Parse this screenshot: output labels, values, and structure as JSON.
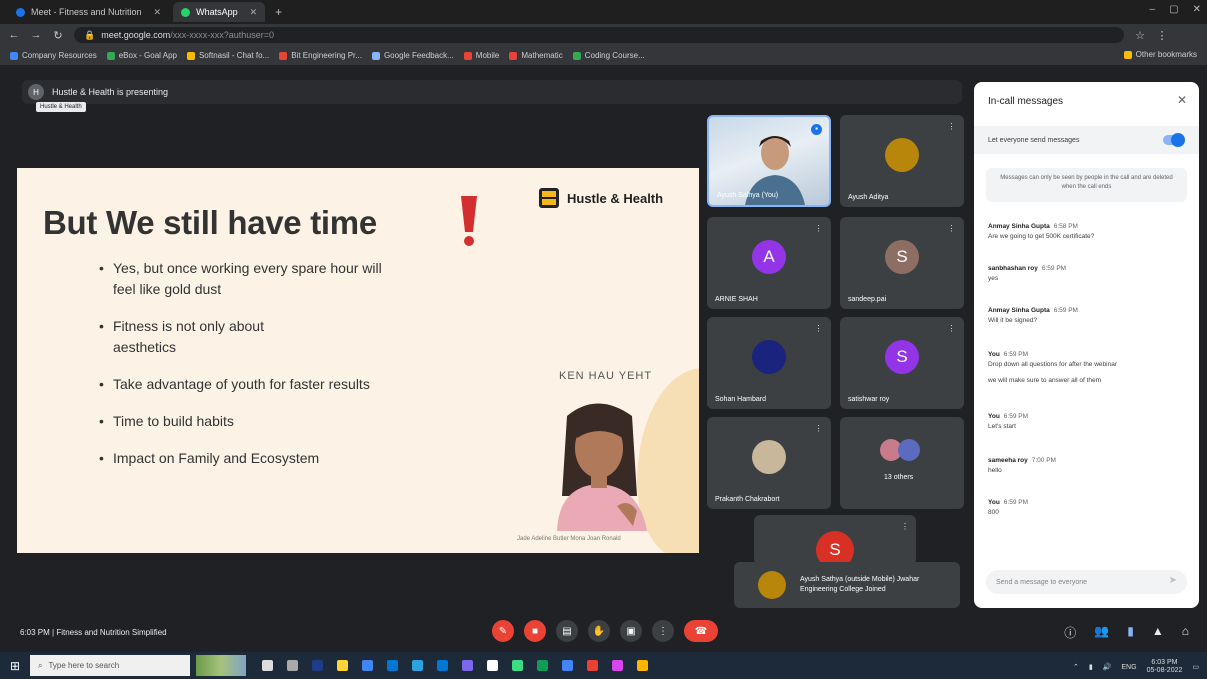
{
  "browser": {
    "tabs": [
      {
        "label": "Meet - Fitness and Nutrition",
        "active": false,
        "color": "#1a73e8"
      },
      {
        "label": "WhatsApp",
        "active": true,
        "color": "#25d366"
      }
    ],
    "new_tab": "+",
    "url": "meet.google.com",
    "url_rest": "/xxx-xxxx-xxx?authuser=0",
    "window_controls": [
      "–",
      "▢",
      "✕"
    ]
  },
  "bookmarks": {
    "items": [
      "Company Resources",
      "eBox - Goal App",
      "Softnasil - Chat fo...",
      "Bit Engineering Pr...",
      "Google Feedback...",
      "Mobile",
      "Mathematic",
      "Coding Course...",
      "Other bookmarks"
    ],
    "colors": [
      "#4285f4",
      "#34a853",
      "#fbbc04",
      "#ea4335",
      "#8ab4f8",
      "#ea4335",
      "#ea4335",
      "#34a853",
      "#fbbc04"
    ]
  },
  "meet": {
    "presenter_bar": "Hustle & Health is presenting",
    "tooltip": "Hustle & Health"
  },
  "slide": {
    "title": "But We still have time",
    "brand": "Hustle & Health",
    "bullets": [
      "Yes, but once working every spare hour will feel like gold dust",
      "Fitness is not only about aesthetics",
      "Take advantage of youth for faster results",
      "Time to build habits",
      "Impact on Family and Ecosystem"
    ],
    "speaker": "KEN HAU YEHT",
    "credit": "Jade Adeline Butler Mona Joan Ronald"
  },
  "participants": [
    {
      "name": "Ayush Salhya (You)",
      "initial": "",
      "color": "",
      "type": "video"
    },
    {
      "name": "Ayush Aditya",
      "initial": "",
      "color": "#b8860b",
      "type": "photo"
    },
    {
      "name": "ARNIE SHAH",
      "initial": "A",
      "color": "#9334e6",
      "type": "letter"
    },
    {
      "name": "sandeep.pai",
      "initial": "S",
      "color": "#8d6e63",
      "type": "letter"
    },
    {
      "name": "Sohan Hambard",
      "initial": "",
      "color": "#1a237e",
      "type": "photo"
    },
    {
      "name": "satishwar roy",
      "initial": "S",
      "color": "#9334e6",
      "type": "letter"
    },
    {
      "name": "Prakanth Chakrabort",
      "initial": "",
      "color": "#c9b79c",
      "type": "photo"
    },
    {
      "name": "13 others",
      "initial": "",
      "color": "",
      "type": "group"
    }
  ],
  "presenting_tile": {
    "initial": "S"
  },
  "pin_card": {
    "text": "Ayush Sathya (outside Mobile) Jwahar Engineering College Joined"
  },
  "chat": {
    "header": "In-call messages",
    "toggle_label": "Let everyone send messages",
    "notice": "Messages can only be seen by people in the call and are deleted when the call ends",
    "messages": [
      {
        "who": "Anmay Sinha Gupta",
        "time": "6:58 PM",
        "text": "Are we going to get 500K certificate?"
      },
      {
        "who": "sanbhashan roy",
        "time": "6:59 PM",
        "text": "yes"
      },
      {
        "who": "Anmay Sinha Gupta",
        "time": "6:59 PM",
        "text": "Will it be signed?"
      },
      {
        "who": "You",
        "time": "6:59 PM",
        "text": "Drop down all questions for after the webinar",
        "text2": "we will make sure to answer all of them"
      },
      {
        "who": "You",
        "time": "6:59 PM",
        "text": "Let's start"
      },
      {
        "who": "sameeha roy",
        "time": "7:00 PM",
        "text": "hello"
      },
      {
        "who": "You",
        "time": "6:59 PM",
        "text": "800"
      }
    ],
    "input_placeholder": "Send a message to everyone"
  },
  "bottom_bar": {
    "meeting_info": "6:03 PM  |  Fitness and Nutrition Simplified",
    "right_icons": [
      "info-icon",
      "people-icon",
      "chat-icon",
      "activities-icon",
      "lock-icon"
    ]
  },
  "taskbar": {
    "search_placeholder": "Type here to search",
    "tray_text": "ENG",
    "time": "6:03 PM",
    "date": "05-08-2022",
    "app_colors": [
      "#1f3c88",
      "#ffd43b",
      "#4285f4",
      "#0078d4",
      "#2aa3e0",
      "#0078d4",
      "#7b68ee",
      "#fff",
      "#3ddc84",
      "#0f9d58",
      "#4285f4",
      "#e94235",
      "#d946ef",
      "#ffb400"
    ]
  }
}
